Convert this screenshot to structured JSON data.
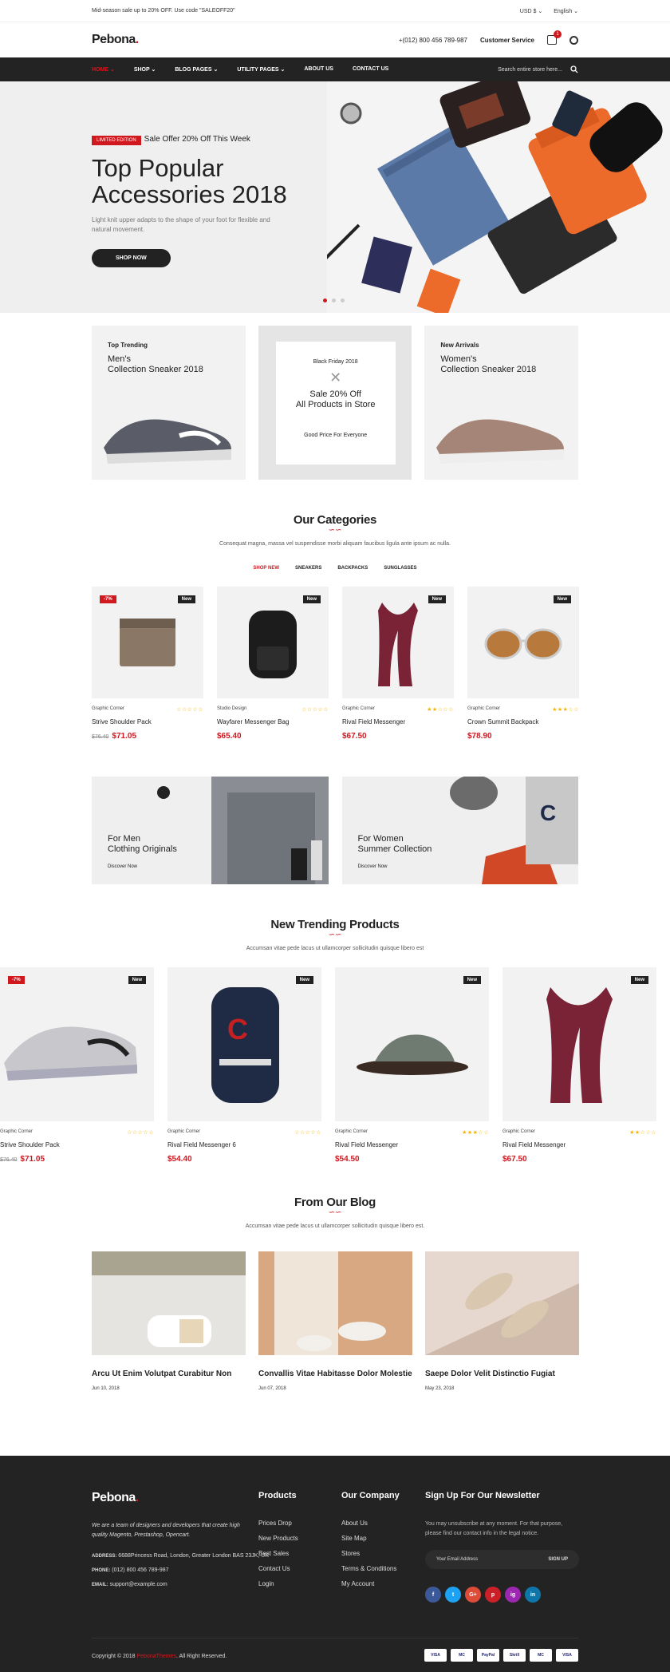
{
  "topbar": {
    "promo": "Mid-season sale up to 20% OFF. Use code \"SALEOFF20\"",
    "currency": "USD $",
    "language": "English"
  },
  "header": {
    "logo": "Pebona",
    "logo_dot": ".",
    "phone": "+(012) 800 456 789-987",
    "customer_service": "Customer Service",
    "cart_count": "1"
  },
  "nav": {
    "items": [
      {
        "label": "HOME"
      },
      {
        "label": "SHOP"
      },
      {
        "label": "BLOG PAGES"
      },
      {
        "label": "UTILITY PAGES"
      },
      {
        "label": "ABOUT US"
      },
      {
        "label": "CONTACT US"
      }
    ],
    "search_placeholder": "Search entire store here..."
  },
  "hero": {
    "tag": "LIMITED EDITION",
    "offer": "Sale Offer 20% Off This Week",
    "title_line1": "Top Popular",
    "title_line2": "Accessories 2018",
    "desc": "Light knit upper adapts to the shape of your foot for flexible and natural movement.",
    "button": "SHOP NOW"
  },
  "promos": {
    "left": {
      "eyebrow": "Top Trending",
      "line1": "Men's",
      "line2": "Collection Sneaker 2018"
    },
    "mid": {
      "top": "Black Friday 2018",
      "line1": "Sale 20% Off",
      "line2": "All Products in Store",
      "bottom": "Good Price For Everyone"
    },
    "right": {
      "eyebrow": "New Arrivals",
      "line1": "Women's",
      "line2": "Collection Sneaker 2018"
    }
  },
  "categories": {
    "title": "Our Categories",
    "wave": "∽∽",
    "desc": "Consequat magna, massa vel suspendisse morbi aliquam faucibus ligula ante ipsum ac nulla.",
    "tabs": [
      "SHOP NEW",
      "SNEAKERS",
      "BACKPACKS",
      "SUNGLASSES"
    ],
    "products": [
      {
        "sale": "-7%",
        "badge": "New",
        "brand": "Graphic Corner",
        "stars": "☆☆☆☆☆",
        "name": "Strive Shoulder Pack",
        "old": "$76.40",
        "price": "$71.05"
      },
      {
        "badge": "New",
        "brand": "Studio Design",
        "stars": "☆☆☆☆☆",
        "name": "Wayfarer Messenger Bag",
        "price": "$65.40"
      },
      {
        "badge": "New",
        "brand": "Graphic Corner",
        "stars": "★★☆☆☆",
        "name": "Rival Field Messenger",
        "price": "$67.50"
      },
      {
        "badge": "New",
        "brand": "Graphic Corner",
        "stars": "★★★☆☆",
        "name": "Crown Summit Backpack",
        "price": "$78.90"
      }
    ]
  },
  "banners": [
    {
      "line1": "For Men",
      "line2": "Clothing Originals",
      "link": "Discover Now"
    },
    {
      "line1": "For Women",
      "line2": "Summer Collection",
      "link": "Discover Now"
    }
  ],
  "trending": {
    "title": "New Trending Products",
    "wave": "∽∽",
    "desc": "Accumsan vitae pede lacus ut ullamcorper sollicitudin quisque libero est",
    "products": [
      {
        "sale": "-7%",
        "badge": "New",
        "brand": "Graphic Corner",
        "stars": "☆☆☆☆☆",
        "name": "Strive Shoulder Pack",
        "old": "$76.40",
        "price": "$71.05"
      },
      {
        "badge": "New",
        "brand": "Graphic Corner",
        "stars": "☆☆☆☆☆",
        "name": "Rival Field Messenger 6",
        "price": "$54.40"
      },
      {
        "badge": "New",
        "brand": "Graphic Corner",
        "stars": "★★★☆☆",
        "name": "Rival Field Messenger",
        "price": "$54.50"
      },
      {
        "badge": "New",
        "brand": "Graphic Corner",
        "stars": "★★☆☆☆",
        "name": "Rival Field Messenger",
        "price": "$67.50"
      }
    ]
  },
  "blog": {
    "title": "From Our Blog",
    "wave": "∽∽",
    "desc": "Accumsan vitae pede lacus ut ullamcorper sollicitudin quisque libero est.",
    "posts": [
      {
        "title": "Arcu Ut Enim Volutpat Curabitur Non",
        "date": "Jun 10, 2018"
      },
      {
        "title": "Convallis Vitae Habitasse Dolor Molestie",
        "date": "Jun 07, 2018"
      },
      {
        "title": "Saepe Dolor Velit Distinctio Fugiat",
        "date": "May 23, 2018"
      }
    ]
  },
  "footer": {
    "logo": "Pebona",
    "about": "We are a team of designers and developers that create high quality Magento, Prestashop, Opencart.",
    "address_label": "ADDRESS:",
    "address": "6688Princess Road, London, Greater London BAS 23JK, UK",
    "phone_label": "PHONE:",
    "phone": "(012) 800 456 789-987",
    "email_label": "EMAIL:",
    "email": "support@example.com",
    "products_title": "Products",
    "products": [
      "Prices Drop",
      "New Products",
      "Best Sales",
      "Contact Us",
      "Login"
    ],
    "company_title": "Our Company",
    "company": [
      "About Us",
      "Site Map",
      "Stores",
      "Terms & Conditions",
      "My Account"
    ],
    "newsletter_title": "Sign Up For Our Newsletter",
    "newsletter_desc": "You may unsubscribe at any moment. For that purpose, please find our contact info in the legal notice.",
    "email_placeholder": "Your Email Address",
    "signup": "SIGN UP",
    "social": [
      {
        "icon": "f",
        "color": "#3b5998"
      },
      {
        "icon": "t",
        "color": "#1da1f2"
      },
      {
        "icon": "G+",
        "color": "#dd4b39"
      },
      {
        "icon": "p",
        "color": "#cb2027"
      },
      {
        "icon": "ig",
        "color": "#9c27b0"
      },
      {
        "icon": "in",
        "color": "#0e76a8"
      }
    ],
    "copyright_prefix": "Copyright © 2018",
    "copyright_brand": "PebonaThemes",
    "copyright_suffix": ". All Right Reserved.",
    "payments": [
      "VISA",
      "MC",
      "PayPal",
      "Skrill",
      "MC",
      "VISA"
    ]
  }
}
